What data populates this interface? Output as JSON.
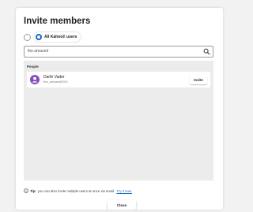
{
  "dialog": {
    "title": "Invite members"
  },
  "audience": {
    "selected_option": "All Kahoot! users"
  },
  "search": {
    "value": "the.amazed",
    "icon": "search-icon"
  },
  "results": {
    "section_label": "People",
    "users": [
      {
        "name": "Darth Vader",
        "handle": "the_amazed2021",
        "avatar_color": "#864cbf",
        "action_label": "Invite"
      }
    ]
  },
  "tip": {
    "label": "Tip:",
    "text": "you can also invite multiple users at once via email.",
    "link_text": "Try it now."
  },
  "footer": {
    "close_label": "Close"
  },
  "colors": {
    "accent": "#1368ce",
    "avatar": "#864cbf",
    "results_bg": "#ececec"
  }
}
